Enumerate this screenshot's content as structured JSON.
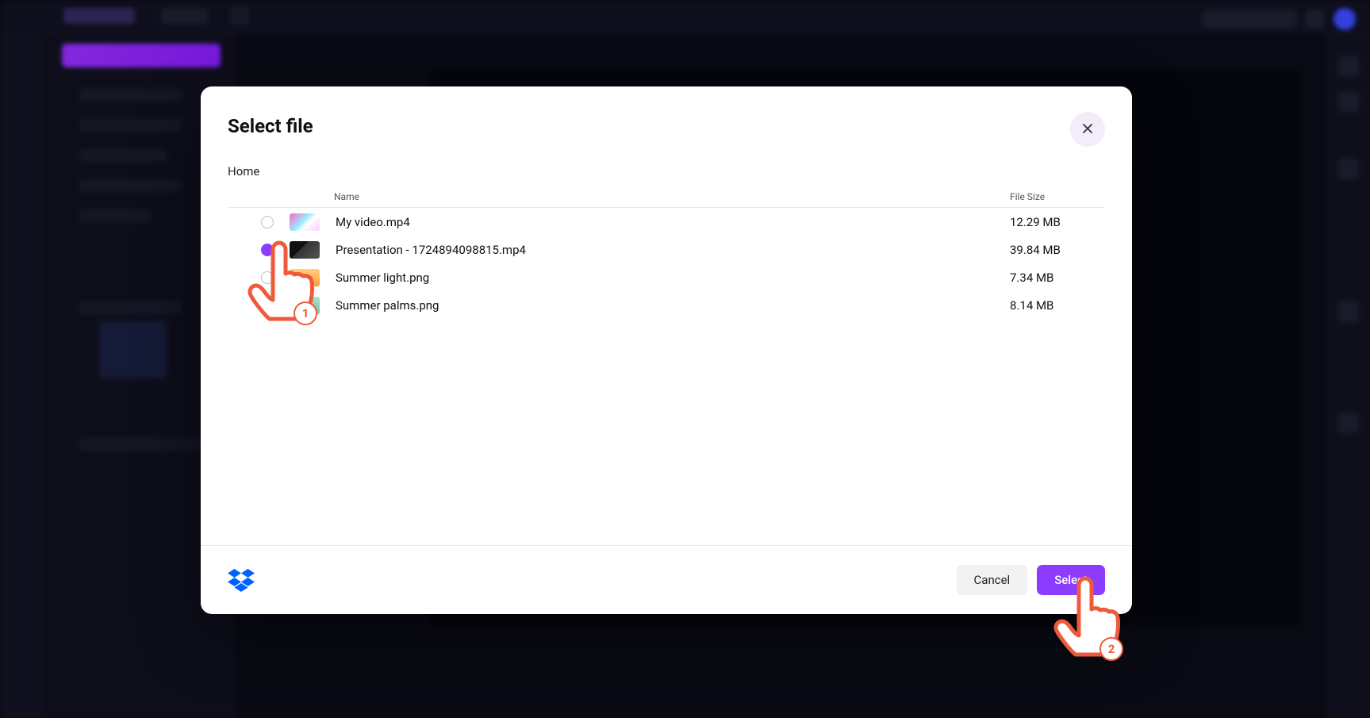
{
  "modal": {
    "title": "Select file",
    "breadcrumb": "Home",
    "columns": {
      "name": "Name",
      "size": "File Size"
    },
    "files": [
      {
        "name": "My video.mp4",
        "size": "12.29 MB",
        "selected": false
      },
      {
        "name": "Presentation - 1724894098815.mp4",
        "size": "39.84 MB",
        "selected": true
      },
      {
        "name": "Summer light.png",
        "size": "7.34 MB",
        "selected": false
      },
      {
        "name": "Summer palms.png",
        "size": "8.14 MB",
        "selected": false
      }
    ],
    "buttons": {
      "cancel": "Cancel",
      "select": "Select"
    }
  },
  "annotations": {
    "step1": "1",
    "step2": "2"
  }
}
